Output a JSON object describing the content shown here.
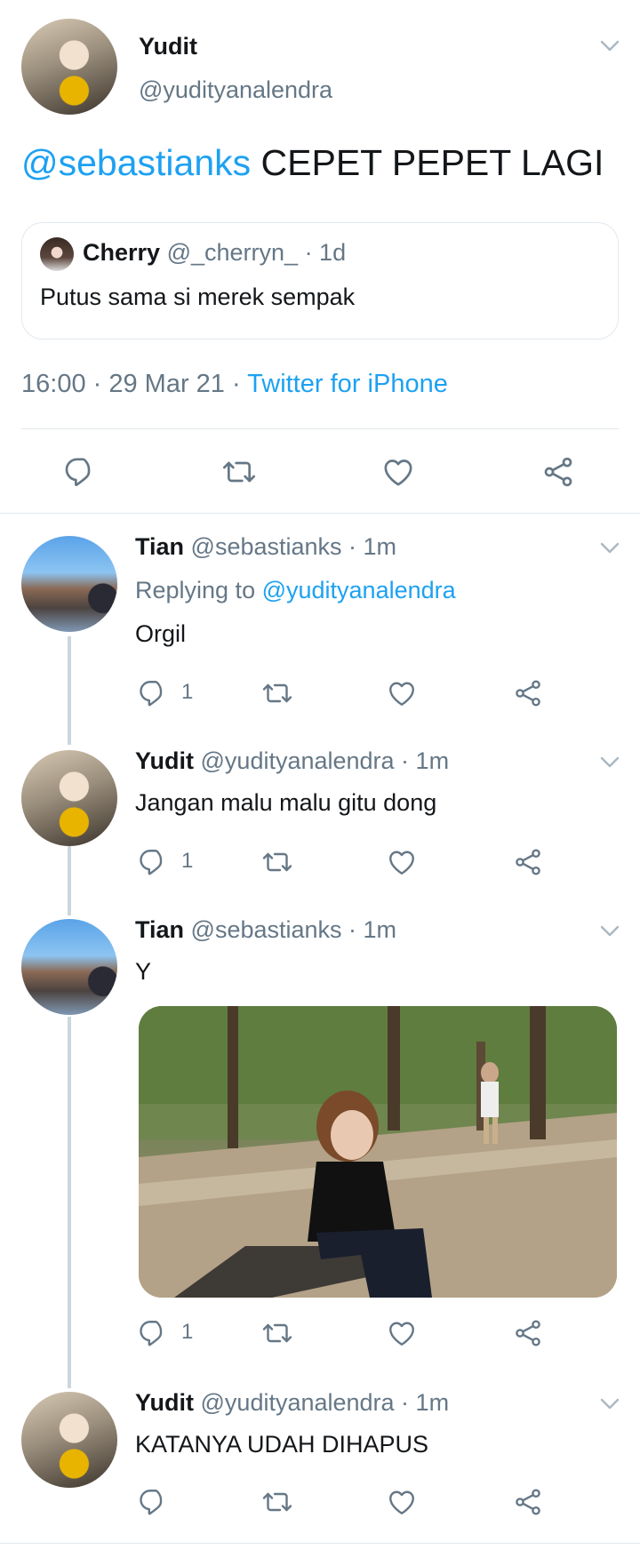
{
  "main_tweet": {
    "name": "Yudit",
    "handle": "@yudityanalendra",
    "mention": "@sebastianks",
    "text": " CEPET PEPET LAGI",
    "quoted": {
      "name": "Cherry",
      "handle": "@_cherryn_",
      "time": "· 1d",
      "text": "Putus sama si merek sempak"
    },
    "meta_time": "16:00 · 29 Mar 21 · ",
    "meta_source": "Twitter for iPhone"
  },
  "replies": [
    {
      "name": "Tian",
      "handle": "@sebastianks · 1m",
      "replying_prefix": "Replying to ",
      "replying_to": "@yudityanalendra",
      "text": "Orgil",
      "reply_count": "1"
    },
    {
      "name": "Yudit",
      "handle": "@yudityanalendra · 1m",
      "text": "Jangan malu malu gitu dong",
      "reply_count": "1"
    },
    {
      "name": "Tian",
      "handle": "@sebastianks · 1m",
      "text": "Y",
      "reply_count": "1"
    },
    {
      "name": "Yudit",
      "handle": "@yudityanalendra · 1m",
      "text": "KATANYA UDAH DIHAPUS",
      "reply_count": ""
    }
  ],
  "icons": {
    "reply": "reply-icon",
    "retweet": "retweet-icon",
    "like": "heart-icon",
    "share": "share-icon",
    "more": "chevron-down-icon"
  },
  "colors": {
    "accent": "#1da1f2",
    "secondary_text": "#657786",
    "divider": "#e1e8ed"
  }
}
